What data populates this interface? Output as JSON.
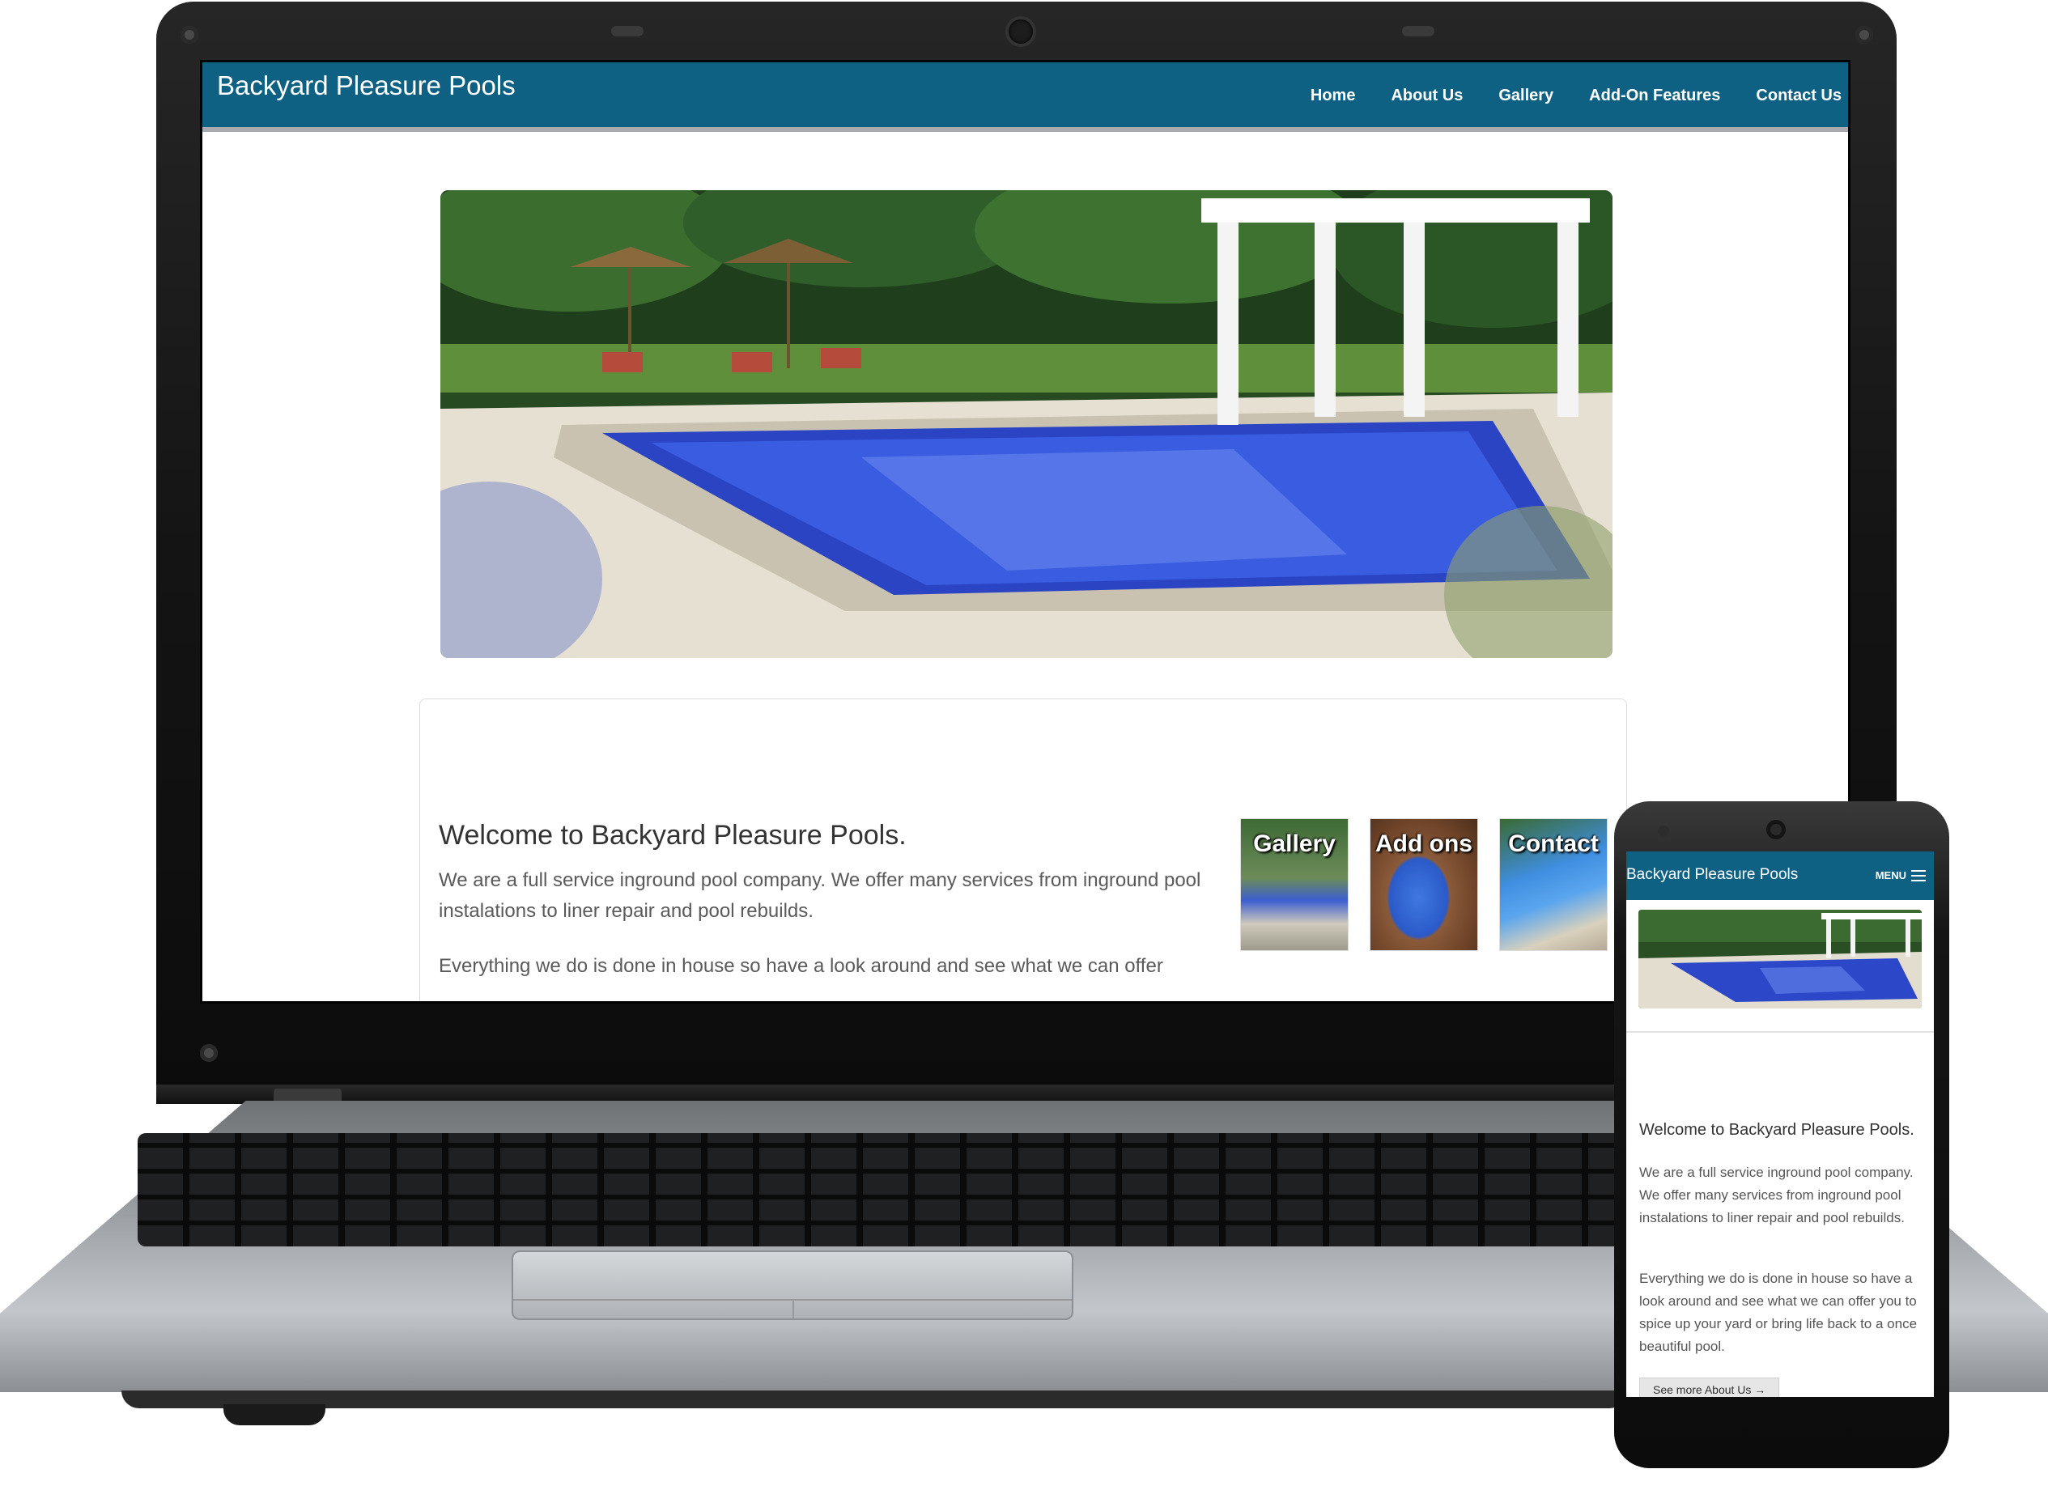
{
  "site": {
    "title": "Backyard Pleasure Pools",
    "nav": [
      "Home",
      "About Us",
      "Gallery",
      "Add-On Features",
      "Contact Us"
    ],
    "welcome_heading": "Welcome to Backyard Pleasure Pools.",
    "paragraph_1": "We are a full service inground pool company. We offer many services from inground pool instalations to liner repair and pool rebuilds.",
    "paragraph_2": "Everything we do is done in house so have a look around and see what we can offer",
    "thumbnails": [
      "Gallery",
      "Add ons",
      "Contact"
    ]
  },
  "mobile": {
    "title": "Backyard Pleasure Pools",
    "menu_label": "MENU",
    "welcome_heading": "Welcome to Backyard Pleasure Pools.",
    "paragraph_1": "We are a full service inground pool company. We offer many services from inground pool instalations to liner repair and pool rebuilds.",
    "paragraph_2": "Everything we do is done in house so have a look around and see what we can offer you to spice up your yard or bring life back to a once beautiful pool.",
    "cta_button": "See more About Us →"
  },
  "colors": {
    "header_blue": "#0f6183",
    "pool_blue": "#2a44c4",
    "foliage_green": "#2f5e2a"
  }
}
